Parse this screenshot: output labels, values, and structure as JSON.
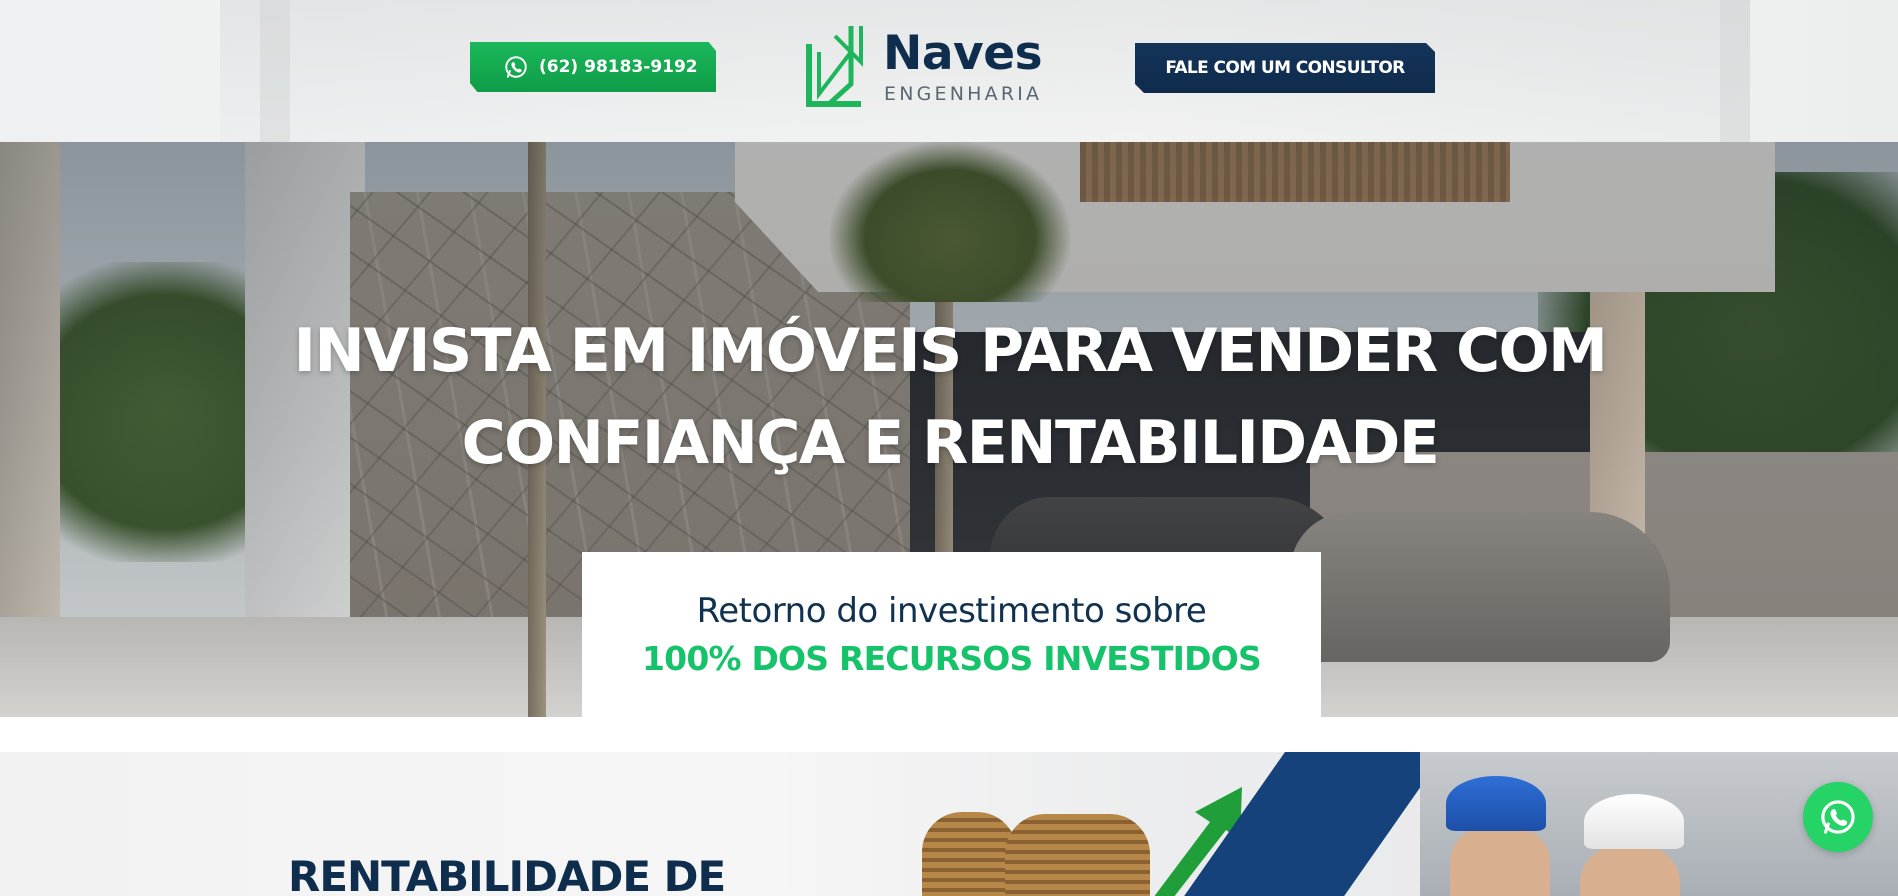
{
  "header": {
    "phone_button": {
      "label": "(62) 98183-9192",
      "icon": "whatsapp-icon"
    },
    "logo": {
      "brand": "Naves",
      "subtitle": "ENGENHARIA"
    },
    "consultant_button": {
      "label": "FALE COM UM CONSULTOR"
    }
  },
  "hero": {
    "title_line1": "INVISTA EM IMÓVEIS PARA VENDER COM",
    "title_line2": "CONFIANÇA E RENTABILIDADE",
    "box_line1": "Retorno do investimento sobre",
    "box_line2": "100% DOS RECURSOS INVESTIDOS"
  },
  "section2": {
    "title": "RENTABILIDADE DE"
  },
  "floating": {
    "whatsapp_icon": "whatsapp-icon"
  },
  "colors": {
    "brand_navy": "#0f2d4d",
    "brand_green": "#16c36a",
    "whatsapp_green": "#25d366"
  }
}
